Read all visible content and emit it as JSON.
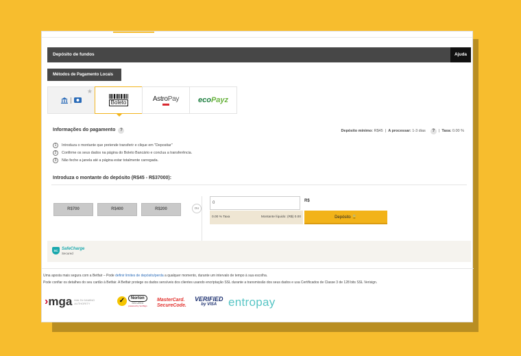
{
  "header": {
    "title": "Depósito de fundos",
    "help_label": "Ajuda"
  },
  "methods_button": {
    "label": "Métodos de Pagamento Locais"
  },
  "payment_methods": [
    {
      "name": "Bank transfer",
      "icons": [
        "bank-icon",
        "card-icon"
      ],
      "favorite_icon": "star-icon"
    },
    {
      "name": "Boleto",
      "logo_text": "Boleto",
      "selected": true
    },
    {
      "name": "AstroPay",
      "logo_text_a": "Astro",
      "logo_text_b": "Pay"
    },
    {
      "name": "ecoPayz",
      "logo_text_a": "eco",
      "logo_text_b": "Payz"
    }
  ],
  "info": {
    "title": "Informações do pagamento",
    "help": "?",
    "min_label": "Depósito mínimo:",
    "min_value": "R$45",
    "processing_label": "A processar:",
    "processing_value": "1-3 dias",
    "fee_label": "Taxa:",
    "fee_value": "0.00 %"
  },
  "steps": [
    {
      "num": "1",
      "text": "Introduza o montante que pretende transferir e clique em \"Depositar\""
    },
    {
      "num": "2",
      "text": "Confirme os seus dados na página do Boleto Bancário e conclua a transferência."
    },
    {
      "num": "3",
      "text": "Não feche a janela até a página estar totalmente carregada."
    }
  ],
  "amount": {
    "title": "Introduza o montante do depósito (R$45 - R$37000):",
    "presets": [
      "R$700",
      "R$400",
      "R$200"
    ],
    "or_label": "OU",
    "input_value": "0",
    "currency": "R$",
    "fee_text": "0.00 % Taxa",
    "net_text": "Montante líquido: (R$) 0.00",
    "deposit_label": "Depósito 🔒"
  },
  "safecharge": {
    "name": "SafeCharge",
    "sub": "Secured",
    "badge": "SC"
  },
  "footer": {
    "line1_pre": "Uma aposta mais segura com a Betfair – Pode ",
    "line1_link": "definir limites de depósito/perda",
    "line1_post": " a qualquer momento, durante um intervalo de tempo à sua escolha.",
    "line2": "Pode confiar os detalhes do seu cartão à Betfair. A Betfair protege os dados sensíveis dos clientes usando encriptação SSL durante a transmissão dos seus dados e usa Certificados de Classe 3 de 128 bits SSL Verisign."
  },
  "logos": {
    "mga_word": "mga",
    "mga_sub": "MALTA GAMING AUTHORITY",
    "norton_name": "Norton",
    "norton_secured": "SECURED",
    "norton_powered": "powered by VeriSign",
    "mastercard_1": "MasterCard.",
    "mastercard_2": "SecureCode.",
    "visa_1": "VERIFIED",
    "visa_2": "by VISA",
    "entropay": "entropay"
  },
  "colors": {
    "background": "#f7bd2e",
    "accent": "#f2b319",
    "header": "#474747"
  }
}
